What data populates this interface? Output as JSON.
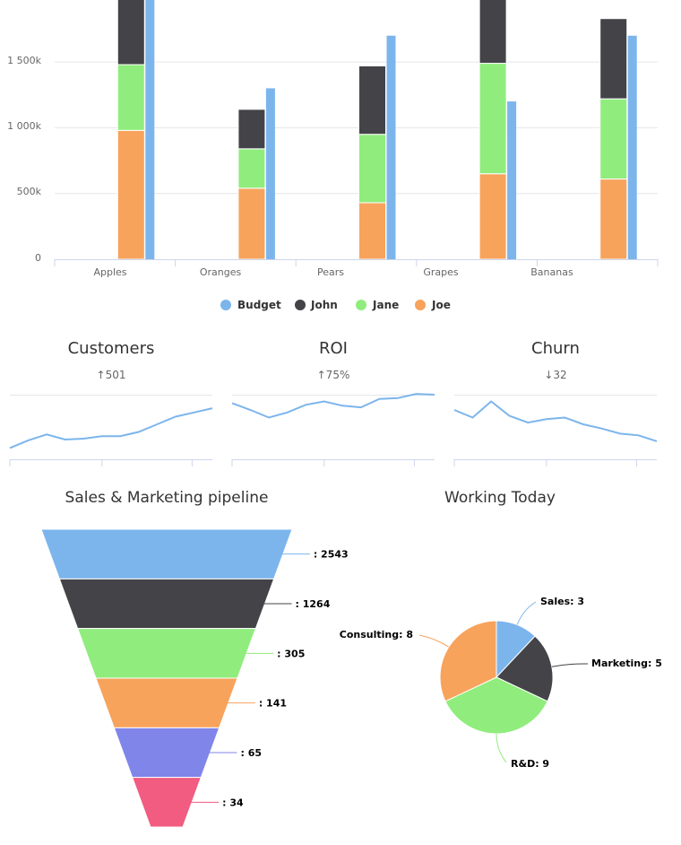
{
  "colors": {
    "Budget": "#7cb5ec",
    "John": "#434348",
    "Jane": "#90ed7d",
    "Joe": "#f7a35c",
    "funnel": [
      "#7cb5ec",
      "#434348",
      "#90ed7d",
      "#f7a35c",
      "#8085e9",
      "#f15c80"
    ],
    "spark": "#7cb5ec"
  },
  "chart_data": [
    {
      "type": "bar",
      "stacked": true,
      "categories": [
        "Apples",
        "Oranges",
        "Pears",
        "Grapes",
        "Bananas"
      ],
      "series": [
        {
          "name": "Joe",
          "stack": "team",
          "values": [
            980,
            540,
            430,
            650,
            610
          ]
        },
        {
          "name": "Jane",
          "stack": "team",
          "values": [
            500,
            300,
            520,
            840,
            610
          ]
        },
        {
          "name": "John",
          "stack": "team",
          "values": [
            540,
            300,
            520,
            520,
            610
          ]
        },
        {
          "name": "Budget",
          "stack": "budget",
          "values": [
            2000,
            1300,
            1700,
            1200,
            1700
          ]
        }
      ],
      "yticks": [
        "0",
        "500k",
        "1 000k",
        "1 500k"
      ],
      "ylim": [
        0,
        1950
      ],
      "legend": [
        "Budget",
        "John",
        "Jane",
        "Joe"
      ],
      "legend_position": "bottom-center",
      "grid": true
    },
    {
      "type": "line",
      "title": "Customers",
      "subtitle": "↑501",
      "values": [
        7,
        16,
        23,
        17,
        18,
        21,
        21,
        26,
        35,
        44,
        49,
        54
      ]
    },
    {
      "type": "line",
      "title": "ROI",
      "subtitle": "↑75%",
      "values": [
        60,
        52,
        43,
        49,
        58,
        62,
        57,
        55,
        65,
        66,
        71,
        70
      ]
    },
    {
      "type": "line",
      "title": "Churn",
      "subtitle": "↓32",
      "values": [
        52,
        43,
        62,
        45,
        37,
        41,
        43,
        35,
        30,
        24,
        22,
        15
      ]
    },
    {
      "type": "funnel",
      "title": "Sales & Marketing pipeline",
      "values": [
        2543,
        1264,
        305,
        141,
        65,
        34
      ],
      "labels": [
        ": 2543",
        ": 1264",
        ": 305",
        ": 141",
        ": 65",
        ": 34"
      ]
    },
    {
      "type": "pie",
      "title": "Working Today",
      "slices": [
        {
          "name": "Sales",
          "value": 3,
          "label": "Sales: 3",
          "color": "#7cb5ec"
        },
        {
          "name": "Marketing",
          "value": 5,
          "label": "Marketing: 5",
          "color": "#434348"
        },
        {
          "name": "R&D",
          "value": 9,
          "label": "R&D: 9",
          "color": "#90ed7d"
        },
        {
          "name": "Consulting",
          "value": 8,
          "label": "Consulting: 8",
          "color": "#f7a35c"
        }
      ]
    }
  ]
}
